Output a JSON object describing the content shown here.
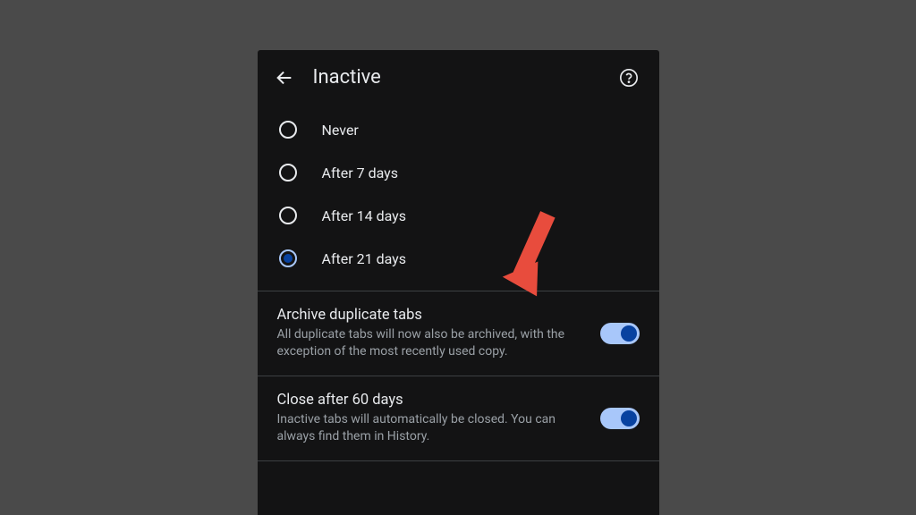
{
  "header": {
    "title": "Inactive"
  },
  "radioOptions": [
    {
      "label": "Never",
      "selected": false
    },
    {
      "label": "After 7 days",
      "selected": false
    },
    {
      "label": "After 14 days",
      "selected": false
    },
    {
      "label": "After 21 days",
      "selected": true
    }
  ],
  "settings": [
    {
      "title": "Archive duplicate tabs",
      "description": "All duplicate tabs will now also be archived, with the exception of the most recently used copy.",
      "enabled": true
    },
    {
      "title": "Close after 60 days",
      "description": "Inactive tabs will automatically be closed. You can always find them in History.",
      "enabled": true
    }
  ],
  "colors": {
    "panelBg": "#131314",
    "textPrimary": "#e8eaed",
    "textSecondary": "#9aa0a6",
    "accent": "#a8c7fa",
    "accentDark": "#0842a0",
    "annotationArrow": "#e84c3d"
  }
}
